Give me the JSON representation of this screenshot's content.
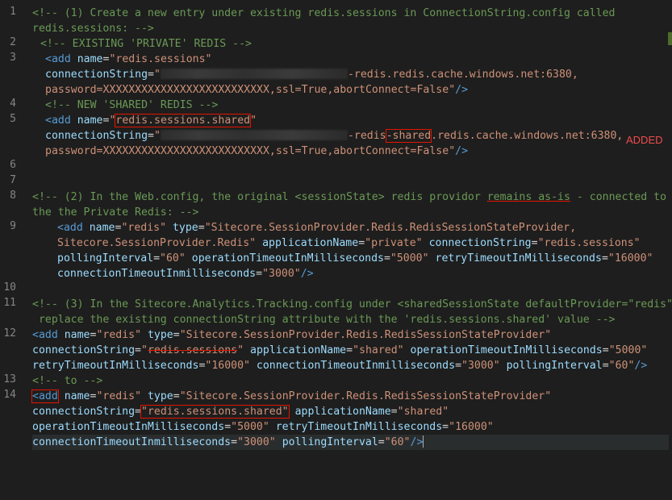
{
  "gutter": [
    "1",
    "2",
    "3",
    "4",
    "5",
    "6",
    "7",
    "8",
    "9",
    "10",
    "11",
    "12",
    "13",
    "14"
  ],
  "added_label": "ADDED",
  "t": {
    "l1a": "<!-- (1) Create a new entry under existing redis.sessions in ConnectionString.config called",
    "l1b": "redis.sessions: -->",
    "l2": " <!-- EXISTING 'PRIVATE' REDIS -->",
    "l3a_tag": "<add",
    "l3a_attr": "name",
    "l3a_val": "\"redis.sessions\"",
    "l3b_attr": "connectionString",
    "l3b_v1": "\"",
    "l3b_v2": "-redis.redis.cache.windows.net:6380,",
    "l3c": "password=XXXXXXXXXXXXXXXXXXXXXXXXXX,ssl=True,abortConnect=False\"",
    "l3c_end": "/>",
    "l4": "<!-- NEW 'SHARED' REDIS -->",
    "l5a_tag": "<add",
    "l5a_attr": "name",
    "l5a_q1": "\"",
    "l5a_box": "redis.sessions.shared",
    "l5a_q2": "\"",
    "l5b_attr": "connectionString",
    "l5b_v1": "\"",
    "l5b_v2": "-redis",
    "l5b_box": "-shared",
    "l5b_v3": ".redis.cache.windows.net:6380,",
    "l5c": "password=XXXXXXXXXXXXXXXXXXXXXXXXXX,ssl=True,abortConnect=False\"",
    "l5c_end": "/>",
    "l8a_1": "<!-- (2) In the Web.config, the original <sessionState> redis providor ",
    "l8a_u": "remains as-is",
    "l8a_2": " - connected to",
    "l8b": "the the Private Redis: -->",
    "l9a": [
      "<add",
      " ",
      "name",
      "=",
      "\"redis\"",
      " ",
      "type",
      "=",
      "\"Sitecore.SessionProvider.Redis.RedisSessionStateProvider,"
    ],
    "l9b": [
      "Sitecore.SessionProvider.Redis\"",
      " ",
      "applicationName",
      "=",
      "\"private\"",
      " ",
      "connectionString",
      "=",
      "\"redis.sessions\""
    ],
    "l9c": [
      "pollingInterval",
      "=",
      "\"60\"",
      " ",
      "operationTimeoutInMilliseconds",
      "=",
      "\"5000\"",
      " ",
      "retryTimeoutInMilliseconds",
      "=",
      "\"16000\""
    ],
    "l9d": [
      "connectionTimeoutInmilliseconds",
      "=",
      "\"3000\"",
      "/>"
    ],
    "l11a": "<!-- (3) In the Sitecore.Analytics.Tracking.config under <sharedSessionState defaultProvider=\"redis\">,",
    "l11b": " replace the existing connectionString attribute with the 'redis.sessions.shared' value -->",
    "l12a": [
      "<add",
      " ",
      "name",
      "=",
      "\"redis\"",
      " ",
      "type",
      "=",
      "\"Sitecore.SessionProvider.Redis.RedisSessionStateProvider\""
    ],
    "l12b_attr": "connectionString",
    "l12b_q1": "\"",
    "l12b_strike": "redis.sessions",
    "l12b_q2": "\"",
    "l12b_rest": [
      "applicationName",
      "=",
      "\"shared\"",
      " ",
      "operationTimeoutInMilliseconds",
      "=",
      "\"5000\""
    ],
    "l12c": [
      "retryTimeoutInMilliseconds",
      "=",
      "\"16000\"",
      " ",
      "connectionTimeoutInmilliseconds",
      "=",
      "\"3000\"",
      " ",
      "pollingInterval",
      "=",
      "\"60\"",
      "/>"
    ],
    "l13": "<!-- to -->",
    "l14a": [
      "<add",
      " ",
      "name",
      "=",
      "\"redis\"",
      " ",
      "type",
      "=",
      "\"Sitecore.SessionProvider.Redis.RedisSessionStateProvider\""
    ],
    "l14b_attr": "connectionString",
    "l14b_box": "\"redis.sessions.shared\"",
    "l14b_rest": [
      "applicationName",
      "=",
      "\"shared\""
    ],
    "l14c": [
      "operationTimeoutInMilliseconds",
      "=",
      "\"5000\"",
      " ",
      "retryTimeoutInMilliseconds",
      "=",
      "\"16000\""
    ],
    "l14d": [
      "connectionTimeoutInmilliseconds",
      "=",
      "\"3000\"",
      " ",
      "pollingInterval",
      "=",
      "\"60\"",
      "/>"
    ]
  },
  "colors": {
    "background": "#1e1e1e",
    "comment": "#6a9955",
    "tag": "#569cd6",
    "attribute": "#9cdcfe",
    "string": "#ce9178",
    "annotation": "#e51400"
  }
}
